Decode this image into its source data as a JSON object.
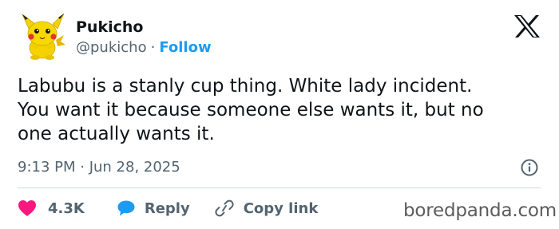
{
  "author": {
    "display_name": "Pukicho",
    "handle": "@pukicho",
    "separator": "·",
    "follow_label": "Follow",
    "avatar_icon": "pikachu-plush-avatar"
  },
  "platform_logo": "x-logo-icon",
  "tweet": {
    "lines": [
      "Labubu is a stanly cup thing. White lady incident.",
      "You want it because someone else wants it, but no",
      "one actually wants it."
    ],
    "timestamp": "9:13 PM · Jun 28, 2025"
  },
  "actions": {
    "likes": "4.3K",
    "reply_label": "Reply",
    "copy_link_label": "Copy link"
  },
  "watermark": "boredpanda.com",
  "colors": {
    "follow_blue": "#1d9bf0",
    "like_red": "#f91880",
    "reply_blue": "#1d9bf0",
    "muted_gray": "#536471"
  }
}
